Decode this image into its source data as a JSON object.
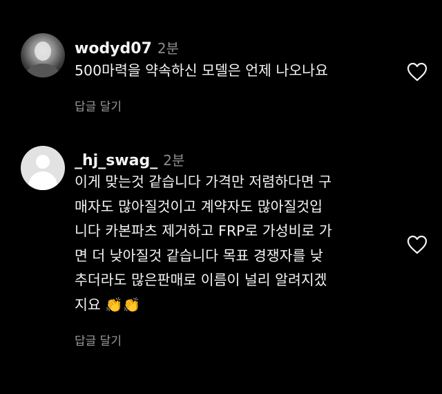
{
  "comments": [
    {
      "username": "wodyd07",
      "time": "2분",
      "lines": [
        "500마력을 약속하신 모델은 언제 나오나요"
      ],
      "reply_label": "답글 달기"
    },
    {
      "username": "_hj_swag_",
      "time": "2분",
      "lines": [
        "이게 맞는것 같습니다 가격만 저렴하다면 구",
        "매자도 많아질것이고 계약자도 많아질것입",
        "니다 카본파츠 제거하고 FRP로 가성비로 가",
        "면 더 낮아질것 같습니다 목표 경쟁자를 낮",
        "추더라도 많은판매로 이름이 널리 알려지겠",
        "지요"
      ],
      "emoji": "👏👏",
      "reply_label": "답글 달기"
    }
  ],
  "icons": {
    "like": "heart-outline-icon",
    "avatar_default": "default-profile-icon"
  },
  "colors": {
    "background": "#000000",
    "text": "#f5f5f5",
    "muted": "#8e8e8e"
  }
}
